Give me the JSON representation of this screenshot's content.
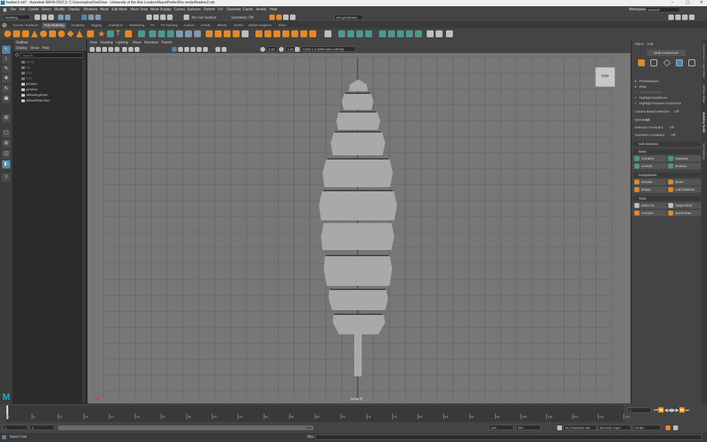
{
  "titlebar": {
    "title": "feather2.mb* - Autodesk MAYA 2022.3: C:\\Users\\adra\\OneDrive - University of the Arts London\\Maya\\PerfectDrs model\\feather2.mb",
    "min": "–",
    "max": "▢",
    "close": "✕"
  },
  "menubar": {
    "items": [
      "File",
      "Edit",
      "Create",
      "Select",
      "Modify",
      "Display",
      "Windows",
      "Mesh",
      "Edit Mesh",
      "Mesh Tools",
      "Mesh Display",
      "Curves",
      "Surfaces",
      "Deform",
      "UV",
      "Generate",
      "Cache",
      "Arnold",
      "Help"
    ],
    "workspace_label": "Workspace:",
    "workspace_value": "General*"
  },
  "statusline": {
    "menuset": "Modeling",
    "live_surface": "No Live Surface",
    "symmetry": "Symmetry: Off",
    "user": "ann.greybrown"
  },
  "shelf": {
    "tabs": [
      "Curves / Surfaces",
      "Poly Modeling",
      "Sculpting",
      "Rigging",
      "Animation",
      "Rendering",
      "FX",
      "FX Caching",
      "Custom",
      "Arnold",
      "Bifrost",
      "MASH",
      "Motion Graphics",
      "XGen"
    ],
    "active_tab": 1
  },
  "outliner": {
    "title": "Outliner",
    "menu": [
      "Display",
      "Show",
      "Help"
    ],
    "search_placeholder": "Search...",
    "items": [
      {
        "label": "persp",
        "dim": true
      },
      {
        "label": "top",
        "dim": true
      },
      {
        "label": "front",
        "dim": true
      },
      {
        "label": "side",
        "dim": true
      },
      {
        "label": "pCube1",
        "dim": false
      },
      {
        "label": "pCube2",
        "dim": false
      },
      {
        "label": "defaultLightSet",
        "dim": false
      },
      {
        "label": "defaultObjectSet",
        "dim": false
      }
    ]
  },
  "viewport": {
    "menu": [
      "View",
      "Shading",
      "Lighting",
      "Show",
      "Renderer",
      "Panels"
    ],
    "exposure": "0.00",
    "gamma": "1.00",
    "colorspace": "ACES 1.0 SDR-video (sRGB)",
    "camera_label": "persp (f)",
    "viewcube": "TOP"
  },
  "modeling_toolkit": {
    "menu": [
      "Object",
      "Help"
    ],
    "mode_button": "Multi-Component",
    "options": [
      {
        "label": "Pick/Marquee",
        "mark": "●"
      },
      {
        "label": "Drag",
        "mark": "●"
      },
      {
        "label": "Tweak/Marquee",
        "mark": "●"
      },
      {
        "label": "Highlight Backfaces",
        "mark": "✓"
      },
      {
        "label": "Highlight Nearest Component",
        "mark": "✓"
      }
    ],
    "camera_based": "Camera Based Selection",
    "camera_based_value": "Off",
    "symmetry_label": "Symmetry",
    "symmetry_value": "Off",
    "sel_constraint": "Selection Constraint",
    "sel_constraint_value": "Off",
    "xf_constraint": "Transform Constraint",
    "xf_constraint_value": "Off",
    "soft_selection": "Soft Selection",
    "sections": [
      "Mesh",
      "Components",
      "Tools"
    ],
    "mesh_buttons": [
      "Combine",
      "Separate",
      "Smooth",
      "Boolean"
    ],
    "component_buttons": [
      "Extrude",
      "Bevel",
      "Bridge",
      "Add Divisions"
    ],
    "tool_buttons": [
      "Multi-Cut",
      "Target Weld",
      "Connect",
      "Quad Draw"
    ],
    "side_tabs": [
      "Channel Box / Layer Editor",
      "Attribute Editor",
      "Modeling Toolkit",
      "Tool Settings"
    ]
  },
  "timeline": {
    "ticks": [
      "1",
      "5",
      "10",
      "15",
      "20",
      "25",
      "30",
      "35",
      "40",
      "45",
      "50",
      "55",
      "60",
      "65",
      "70",
      "75",
      "80",
      "85",
      "90",
      "95",
      "100",
      "105",
      "110",
      "115",
      "120"
    ],
    "current_frame": "1"
  },
  "range": {
    "start": "1",
    "inner_start": "1",
    "slider_end": "120",
    "end": "120",
    "outer_end": "200",
    "character_set": "No Character Set",
    "anim_layer": "No Anim Layer",
    "fps": "24 fps"
  },
  "helpline": {
    "text": "Select Tool",
    "mel": "MEL"
  },
  "colors": {
    "accent": "#5285a6",
    "orange": "#e08a2c",
    "viewport_bg": "#777777",
    "feather": "#a9a9a9"
  }
}
